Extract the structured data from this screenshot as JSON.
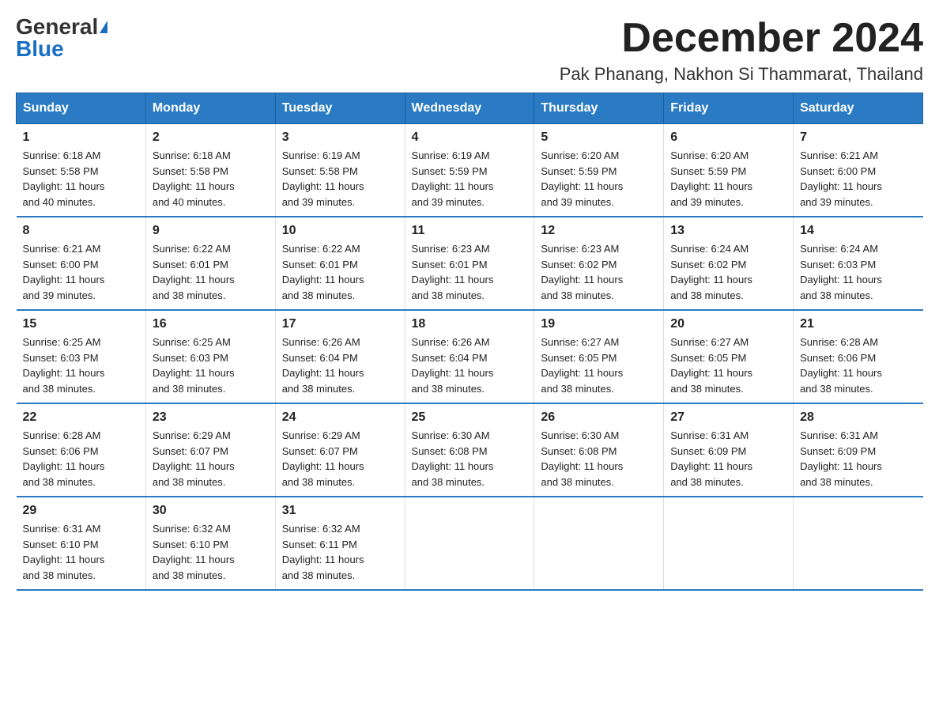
{
  "logo": {
    "general": "General",
    "blue": "Blue"
  },
  "header": {
    "month": "December 2024",
    "location": "Pak Phanang, Nakhon Si Thammarat, Thailand"
  },
  "weekdays": [
    "Sunday",
    "Monday",
    "Tuesday",
    "Wednesday",
    "Thursday",
    "Friday",
    "Saturday"
  ],
  "weeks": [
    [
      {
        "day": "1",
        "sunrise": "6:18 AM",
        "sunset": "5:58 PM",
        "daylight": "11 hours and 40 minutes."
      },
      {
        "day": "2",
        "sunrise": "6:18 AM",
        "sunset": "5:58 PM",
        "daylight": "11 hours and 40 minutes."
      },
      {
        "day": "3",
        "sunrise": "6:19 AM",
        "sunset": "5:58 PM",
        "daylight": "11 hours and 39 minutes."
      },
      {
        "day": "4",
        "sunrise": "6:19 AM",
        "sunset": "5:59 PM",
        "daylight": "11 hours and 39 minutes."
      },
      {
        "day": "5",
        "sunrise": "6:20 AM",
        "sunset": "5:59 PM",
        "daylight": "11 hours and 39 minutes."
      },
      {
        "day": "6",
        "sunrise": "6:20 AM",
        "sunset": "5:59 PM",
        "daylight": "11 hours and 39 minutes."
      },
      {
        "day": "7",
        "sunrise": "6:21 AM",
        "sunset": "6:00 PM",
        "daylight": "11 hours and 39 minutes."
      }
    ],
    [
      {
        "day": "8",
        "sunrise": "6:21 AM",
        "sunset": "6:00 PM",
        "daylight": "11 hours and 39 minutes."
      },
      {
        "day": "9",
        "sunrise": "6:22 AM",
        "sunset": "6:01 PM",
        "daylight": "11 hours and 38 minutes."
      },
      {
        "day": "10",
        "sunrise": "6:22 AM",
        "sunset": "6:01 PM",
        "daylight": "11 hours and 38 minutes."
      },
      {
        "day": "11",
        "sunrise": "6:23 AM",
        "sunset": "6:01 PM",
        "daylight": "11 hours and 38 minutes."
      },
      {
        "day": "12",
        "sunrise": "6:23 AM",
        "sunset": "6:02 PM",
        "daylight": "11 hours and 38 minutes."
      },
      {
        "day": "13",
        "sunrise": "6:24 AM",
        "sunset": "6:02 PM",
        "daylight": "11 hours and 38 minutes."
      },
      {
        "day": "14",
        "sunrise": "6:24 AM",
        "sunset": "6:03 PM",
        "daylight": "11 hours and 38 minutes."
      }
    ],
    [
      {
        "day": "15",
        "sunrise": "6:25 AM",
        "sunset": "6:03 PM",
        "daylight": "11 hours and 38 minutes."
      },
      {
        "day": "16",
        "sunrise": "6:25 AM",
        "sunset": "6:03 PM",
        "daylight": "11 hours and 38 minutes."
      },
      {
        "day": "17",
        "sunrise": "6:26 AM",
        "sunset": "6:04 PM",
        "daylight": "11 hours and 38 minutes."
      },
      {
        "day": "18",
        "sunrise": "6:26 AM",
        "sunset": "6:04 PM",
        "daylight": "11 hours and 38 minutes."
      },
      {
        "day": "19",
        "sunrise": "6:27 AM",
        "sunset": "6:05 PM",
        "daylight": "11 hours and 38 minutes."
      },
      {
        "day": "20",
        "sunrise": "6:27 AM",
        "sunset": "6:05 PM",
        "daylight": "11 hours and 38 minutes."
      },
      {
        "day": "21",
        "sunrise": "6:28 AM",
        "sunset": "6:06 PM",
        "daylight": "11 hours and 38 minutes."
      }
    ],
    [
      {
        "day": "22",
        "sunrise": "6:28 AM",
        "sunset": "6:06 PM",
        "daylight": "11 hours and 38 minutes."
      },
      {
        "day": "23",
        "sunrise": "6:29 AM",
        "sunset": "6:07 PM",
        "daylight": "11 hours and 38 minutes."
      },
      {
        "day": "24",
        "sunrise": "6:29 AM",
        "sunset": "6:07 PM",
        "daylight": "11 hours and 38 minutes."
      },
      {
        "day": "25",
        "sunrise": "6:30 AM",
        "sunset": "6:08 PM",
        "daylight": "11 hours and 38 minutes."
      },
      {
        "day": "26",
        "sunrise": "6:30 AM",
        "sunset": "6:08 PM",
        "daylight": "11 hours and 38 minutes."
      },
      {
        "day": "27",
        "sunrise": "6:31 AM",
        "sunset": "6:09 PM",
        "daylight": "11 hours and 38 minutes."
      },
      {
        "day": "28",
        "sunrise": "6:31 AM",
        "sunset": "6:09 PM",
        "daylight": "11 hours and 38 minutes."
      }
    ],
    [
      {
        "day": "29",
        "sunrise": "6:31 AM",
        "sunset": "6:10 PM",
        "daylight": "11 hours and 38 minutes."
      },
      {
        "day": "30",
        "sunrise": "6:32 AM",
        "sunset": "6:10 PM",
        "daylight": "11 hours and 38 minutes."
      },
      {
        "day": "31",
        "sunrise": "6:32 AM",
        "sunset": "6:11 PM",
        "daylight": "11 hours and 38 minutes."
      },
      null,
      null,
      null,
      null
    ]
  ]
}
